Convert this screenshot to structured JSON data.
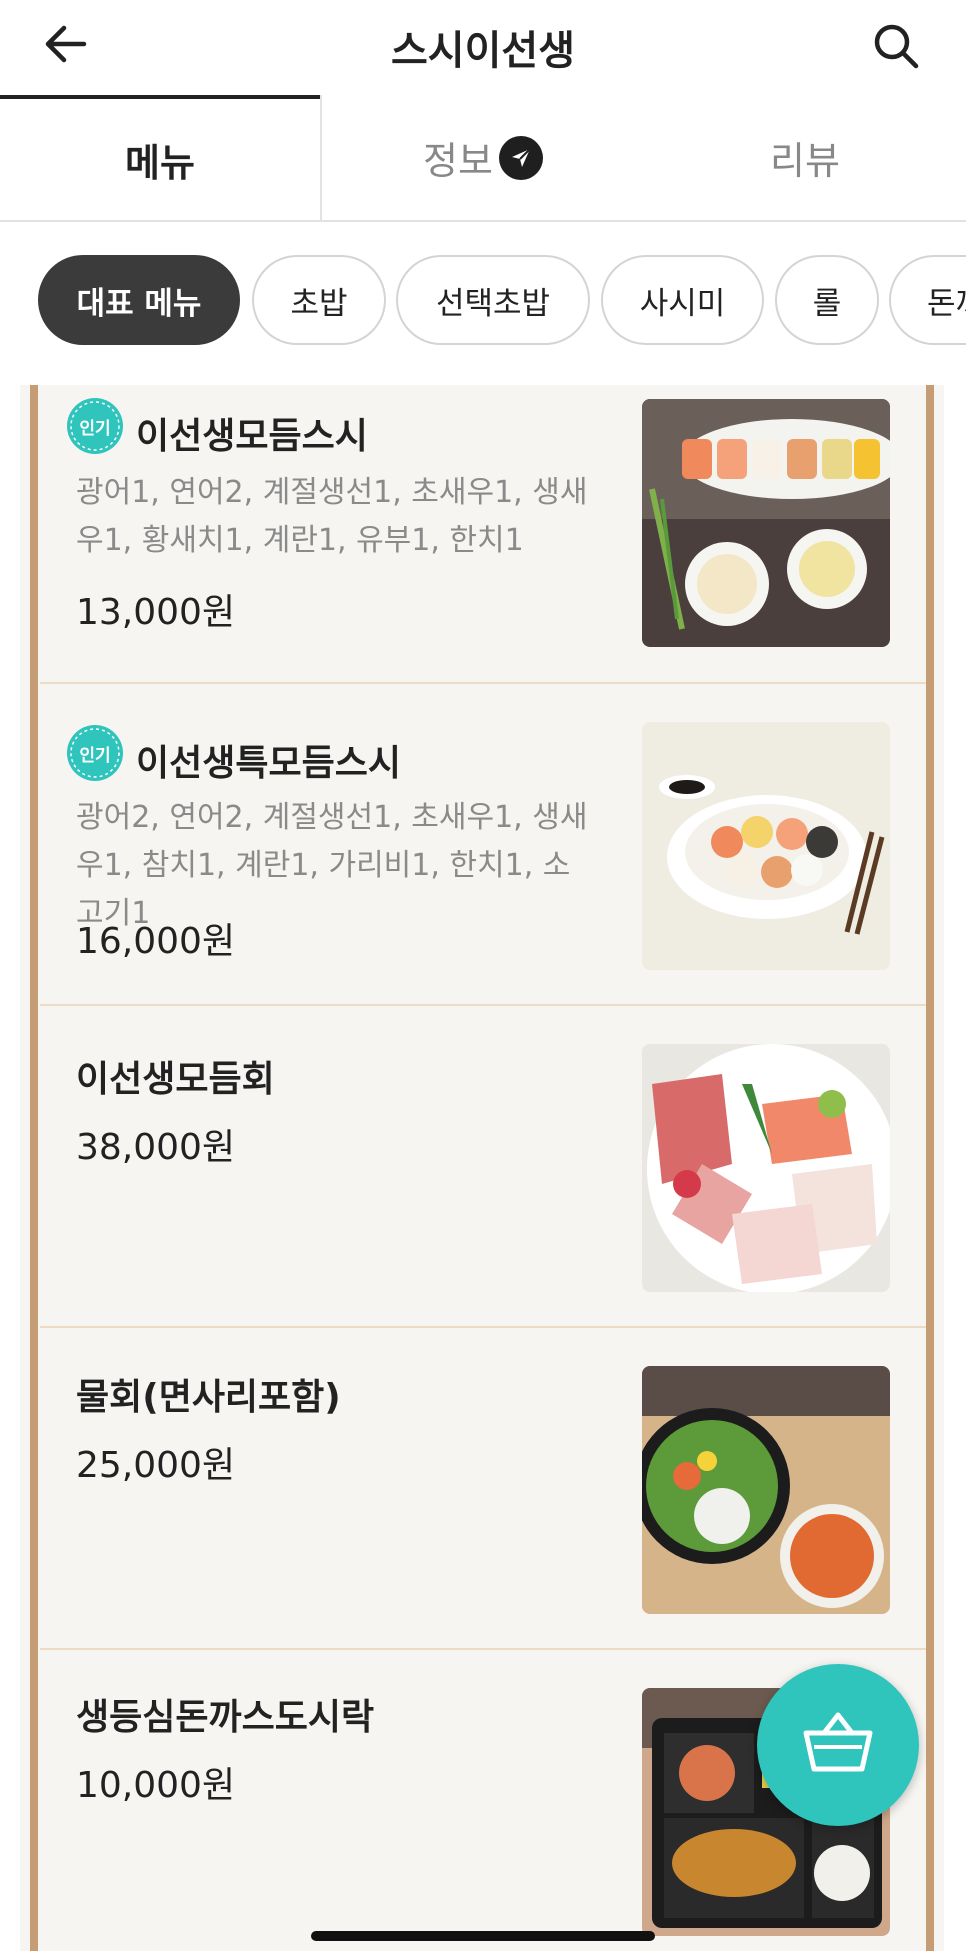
{
  "header": {
    "title": "스시이선생",
    "back_icon": "arrow-left-icon",
    "search_icon": "search-icon"
  },
  "tabs": [
    {
      "label": "메뉴",
      "active": true
    },
    {
      "label": "정보",
      "icon": "send-icon"
    },
    {
      "label": "리뷰"
    }
  ],
  "categories": [
    {
      "label": "대표 메뉴",
      "active": true
    },
    {
      "label": "초밥"
    },
    {
      "label": "선택초밥"
    },
    {
      "label": "사시미"
    },
    {
      "label": "롤"
    },
    {
      "label": "돈까"
    }
  ],
  "menu": [
    {
      "badge": "인기",
      "name": "이선생모듬스시",
      "desc": "광어1, 연어2, 계절생선1, 초새우1, 생새우1, 황새치1, 계란1, 유부1, 한치1",
      "price": "13,000원"
    },
    {
      "badge": "인기",
      "name": "이선생특모듬스시",
      "desc": "광어2, 연어2, 계절생선1, 초새우1, 생새우1, 참치1, 계란1, 가리비1, 한치1, 소고기1",
      "price": "16,000원"
    },
    {
      "name": "이선생모듬회",
      "price": "38,000원"
    },
    {
      "name": "물회(면사리포함)",
      "price": "25,000원"
    },
    {
      "name": "생등심돈까스도시락",
      "price": "10,000원"
    }
  ],
  "cart_icon": "basket-icon",
  "colors": {
    "accent": "#2fc4bc",
    "rail": "#c59d74",
    "chip_active": "#3b3b3b"
  }
}
